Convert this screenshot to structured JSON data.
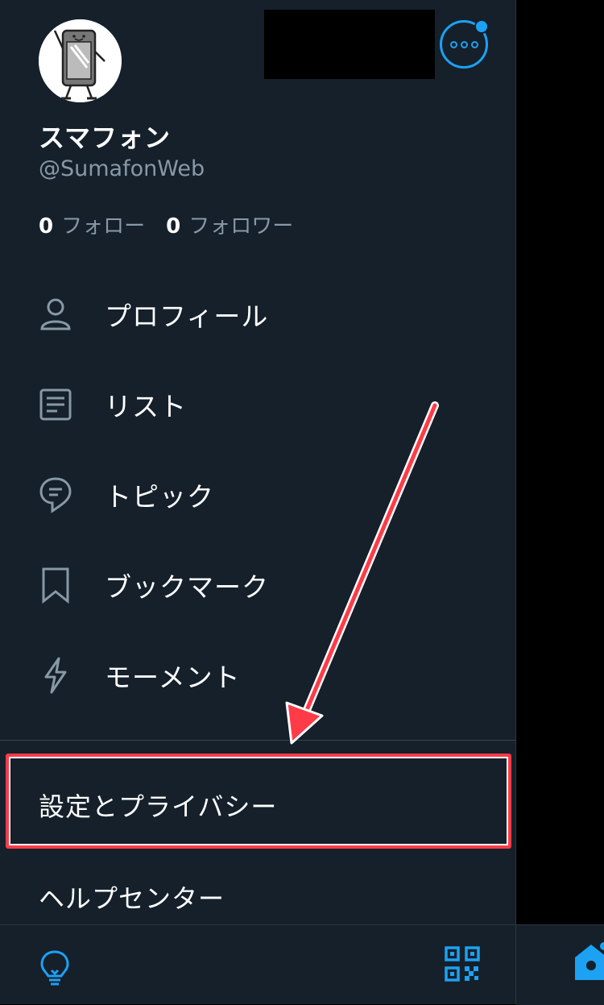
{
  "profile": {
    "name": "スマフォン",
    "handle": "@SumafonWeb",
    "following_count": "0",
    "following_label": "フォロー",
    "followers_count": "0",
    "followers_label": "フォロワー"
  },
  "menu": {
    "items": [
      {
        "label": "プロフィール",
        "icon": "person-icon"
      },
      {
        "label": "リスト",
        "icon": "list-icon"
      },
      {
        "label": "トピック",
        "icon": "topic-icon"
      },
      {
        "label": "ブックマーク",
        "icon": "bookmark-icon"
      },
      {
        "label": "モーメント",
        "icon": "lightning-icon"
      }
    ]
  },
  "settings": {
    "label": "設定とプライバシー"
  },
  "help": {
    "label": "ヘルプセンター"
  },
  "colors": {
    "background": "#15202b",
    "accent": "#1da1f2",
    "annotation": "#ff3b48"
  },
  "bottom": {
    "left_icon": "lightbulb-icon",
    "right_icon": "qr-code-icon"
  }
}
